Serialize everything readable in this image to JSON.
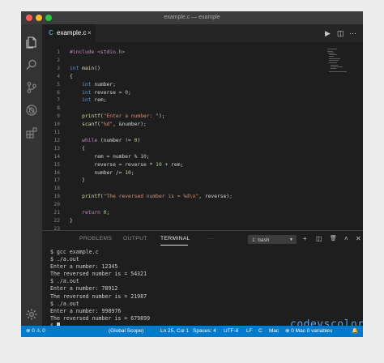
{
  "window": {
    "title": "example.c — example"
  },
  "traffic_lights": {
    "close": "#ff5f57",
    "minimize": "#febc2e",
    "maximize": "#28c840"
  },
  "activity_bar": {
    "icons": [
      "files-icon",
      "search-icon",
      "source-control-icon",
      "debug-icon",
      "extensions-icon"
    ],
    "bottom_icon": "gear-icon"
  },
  "tab": {
    "lang_glyph": "C",
    "filename": "example.c",
    "close_glyph": "×"
  },
  "editor_actions": {
    "run": "▶",
    "split": "◫",
    "more": "···"
  },
  "code_lines": [
    {
      "n": "1",
      "t": "#include <stdio.h>"
    },
    {
      "n": "2",
      "t": ""
    },
    {
      "n": "3",
      "t": "int main()"
    },
    {
      "n": "4",
      "t": "{"
    },
    {
      "n": "5",
      "t": "    int number;"
    },
    {
      "n": "6",
      "t": "    int reverse = 0;"
    },
    {
      "n": "7",
      "t": "    int rem;"
    },
    {
      "n": "8",
      "t": ""
    },
    {
      "n": "9",
      "t": "    printf(\"Enter a number: \");"
    },
    {
      "n": "10",
      "t": "    scanf(\"%d\", &number);"
    },
    {
      "n": "11",
      "t": ""
    },
    {
      "n": "12",
      "t": "    while (number != 0)"
    },
    {
      "n": "13",
      "t": "    {"
    },
    {
      "n": "14",
      "t": "        rem = number % 10;"
    },
    {
      "n": "15",
      "t": "        reverse = reverse * 10 + rem;"
    },
    {
      "n": "16",
      "t": "        number /= 10;"
    },
    {
      "n": "17",
      "t": "    }"
    },
    {
      "n": "18",
      "t": ""
    },
    {
      "n": "19",
      "t": "    printf(\"The reversed number is = %d\\n\", reverse);"
    },
    {
      "n": "20",
      "t": ""
    },
    {
      "n": "21",
      "t": "    return 0;"
    },
    {
      "n": "22",
      "t": "}"
    },
    {
      "n": "23",
      "t": ""
    }
  ],
  "panel": {
    "tabs": [
      "PROBLEMS",
      "OUTPUT",
      "TERMINAL"
    ],
    "active_tab": "TERMINAL",
    "more": "···",
    "shell_select": "1: bash",
    "actions": [
      "+",
      "◫",
      "🗑",
      "˄",
      "✕"
    ]
  },
  "terminal_lines": [
    "$ gcc example.c",
    "$ ./a.out",
    "Enter a number: 12345",
    "The reversed number is = 54321",
    "$ ./a.out",
    "Enter a number: 78912",
    "The reversed number is = 21987",
    "$ ./a.out",
    "Enter a number: 998976",
    "The reversed number is = 679899",
    "$ "
  ],
  "watermark": "codevscolor.com",
  "status_bar": {
    "errors": "⊗ 0 ⚠ 0",
    "scope": "(Global Scope)",
    "position": "Ln 25, Col 1",
    "spaces": "Spaces: 4",
    "encoding": "UTF-8",
    "eol": "LF",
    "language": "C",
    "platform": "Mac",
    "problems": "⊗ 0 Mac 0 variables",
    "bell": "🔔"
  },
  "colors": {
    "accent": "#007acc",
    "editor_bg": "#1e1e1e",
    "keyword": "#569cd6",
    "string": "#ce9178"
  }
}
